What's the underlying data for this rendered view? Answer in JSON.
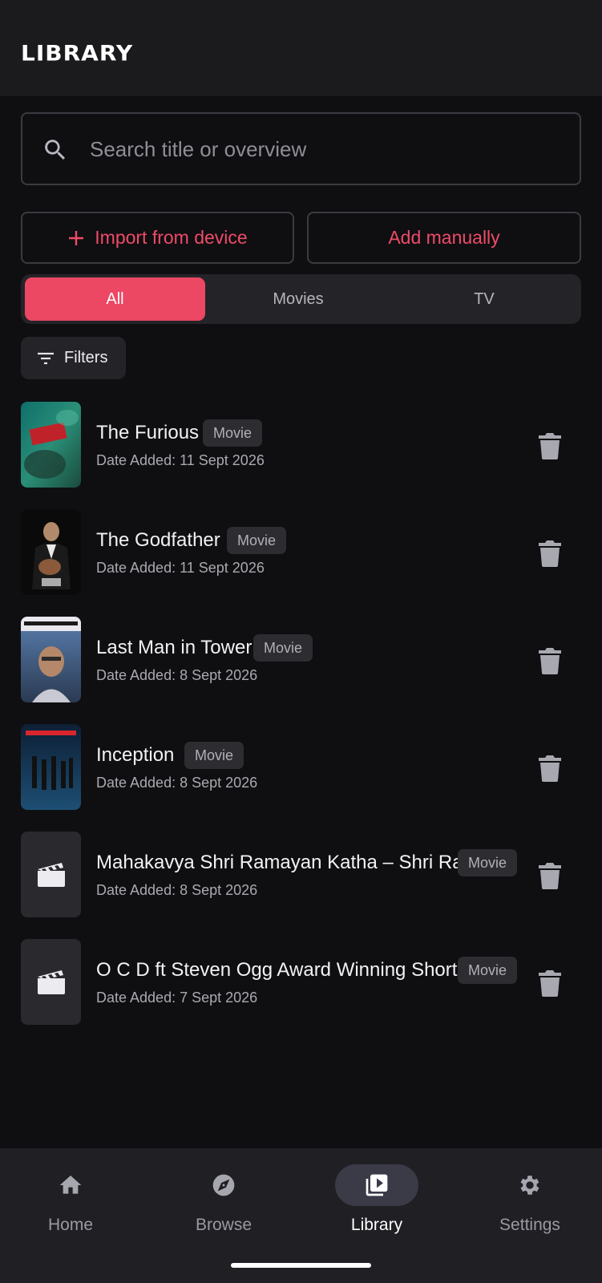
{
  "header": {
    "title": "LIBRARY"
  },
  "search": {
    "placeholder": "Search title or overview",
    "value": ""
  },
  "actions": {
    "import_label": "Import from device",
    "add_label": "Add manually"
  },
  "segments": [
    {
      "label": "All",
      "selected": true
    },
    {
      "label": "Movies",
      "selected": false
    },
    {
      "label": "TV",
      "selected": false
    }
  ],
  "filters_label": "Filters",
  "items": [
    {
      "title": "The Furious",
      "badge": "Movie",
      "date": "Date Added: 11 Sept 2026",
      "poster": "poster-image"
    },
    {
      "title": "The Godfather",
      "badge": "Movie",
      "date": "Date Added: 11 Sept 2026",
      "poster": "poster-image"
    },
    {
      "title": "Last Man in Tower",
      "badge": "Movie",
      "date": "Date Added: 8 Sept 2026",
      "poster": "poster-image"
    },
    {
      "title": "Inception",
      "badge": "Movie",
      "date": "Date Added: 8 Sept 2026",
      "poster": "poster-image"
    },
    {
      "title": "Mahakavya Shri Ramayan Katha – Shri Ram",
      "badge": "Movie",
      "date": "Date Added: 8 Sept 2026",
      "poster": "clapperboard-icon"
    },
    {
      "title": "O C D ft Steven Ogg Award Winning Short",
      "badge": "Movie",
      "date": "Date Added: 7 Sept 2026",
      "poster": "clapperboard-icon"
    }
  ],
  "nav": [
    {
      "label": "Home",
      "icon": "home-icon",
      "active": false
    },
    {
      "label": "Browse",
      "icon": "compass-icon",
      "active": false
    },
    {
      "label": "Library",
      "icon": "video-library-icon",
      "active": true
    },
    {
      "label": "Settings",
      "icon": "gear-icon",
      "active": false
    }
  ],
  "colors": {
    "accent": "#ec4763",
    "background": "#0f0f12",
    "surface": "#242428"
  }
}
